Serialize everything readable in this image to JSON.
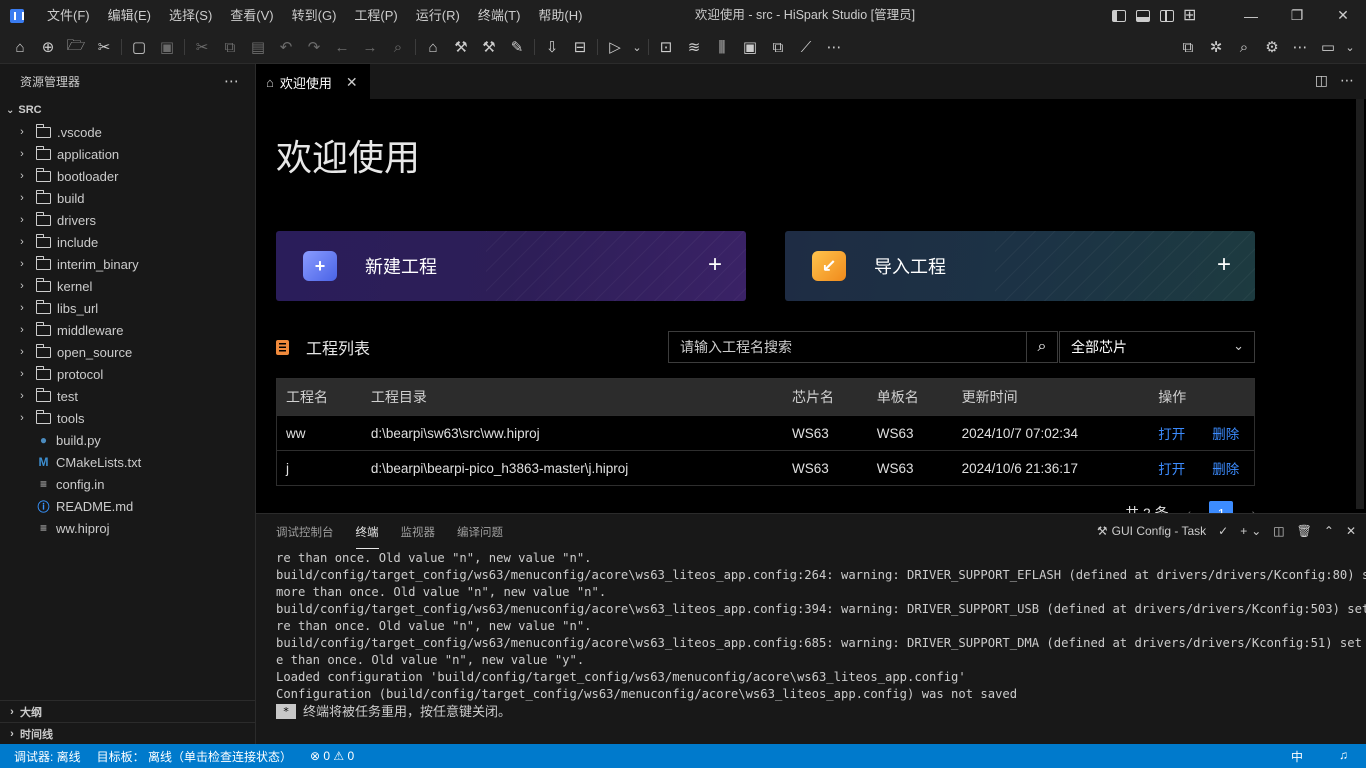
{
  "titlebar": {
    "menu": [
      "文件(F)",
      "编辑(E)",
      "选择(S)",
      "查看(V)",
      "转到(G)",
      "工程(P)",
      "运行(R)",
      "终端(T)",
      "帮助(H)"
    ],
    "title": "欢迎使用 - src - HiSpark Studio [管理员]"
  },
  "sidebar": {
    "title": "资源管理器",
    "root": "SRC",
    "folders": [
      ".vscode",
      "application",
      "bootloader",
      "build",
      "drivers",
      "include",
      "interim_binary",
      "kernel",
      "libs_url",
      "middleware",
      "open_source",
      "protocol",
      "test",
      "tools"
    ],
    "files": [
      {
        "name": "build.py",
        "icon": "python-icon"
      },
      {
        "name": "CMakeLists.txt",
        "icon": "cmake-icon"
      },
      {
        "name": "config.in",
        "icon": "lines-icon"
      },
      {
        "name": "README.md",
        "icon": "info-icon"
      },
      {
        "name": "ww.hiproj",
        "icon": "lines-icon"
      }
    ],
    "outline": "大纲",
    "timeline": "时间线"
  },
  "editor": {
    "tab_label": "欢迎使用"
  },
  "welcome": {
    "title": "欢迎使用",
    "new_project": "新建工程",
    "import_project": "导入工程",
    "list_title": "工程列表",
    "search_placeholder": "请输入工程名搜索",
    "chip_filter": "全部芯片",
    "columns": [
      "工程名",
      "工程目录",
      "芯片名",
      "单板名",
      "更新时间",
      "操作"
    ],
    "rows": [
      {
        "name": "ww",
        "dir": "d:\\bearpi\\sw63\\src\\ww.hiproj",
        "chip": "WS63",
        "board": "WS63",
        "time": "2024/10/7 07:02:34"
      },
      {
        "name": "j",
        "dir": "d:\\bearpi\\bearpi-pico_h3863-master\\j.hiproj",
        "chip": "WS63",
        "board": "WS63",
        "time": "2024/10/6 21:36:17"
      }
    ],
    "action_open": "打开",
    "action_delete": "删除",
    "total": "共 2 条",
    "current_page": "1"
  },
  "panel": {
    "tabs": [
      "调试控制台",
      "终端",
      "监视器",
      "编译问题"
    ],
    "task_label": "GUI Config - Task",
    "lines": [
      "re than once. Old value \"n\", new value \"n\".",
      "build/config/target_config/ws63/menuconfig/acore\\ws63_liteos_app.config:264: warning: DRIVER_SUPPORT_EFLASH (defined at drivers/drivers/Kconfig:80) set",
      "more than once. Old value \"n\", new value \"n\".",
      "build/config/target_config/ws63/menuconfig/acore\\ws63_liteos_app.config:394: warning: DRIVER_SUPPORT_USB (defined at drivers/drivers/Kconfig:503) set mo",
      "re than once. Old value \"n\", new value \"n\".",
      "build/config/target_config/ws63/menuconfig/acore\\ws63_liteos_app.config:685: warning: DRIVER_SUPPORT_DMA (defined at drivers/drivers/Kconfig:51) set mor",
      "e than once. Old value \"n\", new value \"y\".",
      "Loaded configuration 'build/config/target_config/ws63/menuconfig/acore\\ws63_liteos_app.config'",
      "Configuration (build/config/target_config/ws63/menuconfig/acore\\ws63_liteos_app.config) was not saved"
    ],
    "reuse_msg": "终端将被任务重用，按任意键关闭。"
  },
  "statusbar": {
    "debugger": "调试器: 离线",
    "target": "目标板： 离线（单击检查连接状态）",
    "problems": "⊗ 0 ⚠ 0",
    "lang": "中"
  },
  "colors": {
    "accent": "#007acc",
    "link": "#3c8cff"
  }
}
